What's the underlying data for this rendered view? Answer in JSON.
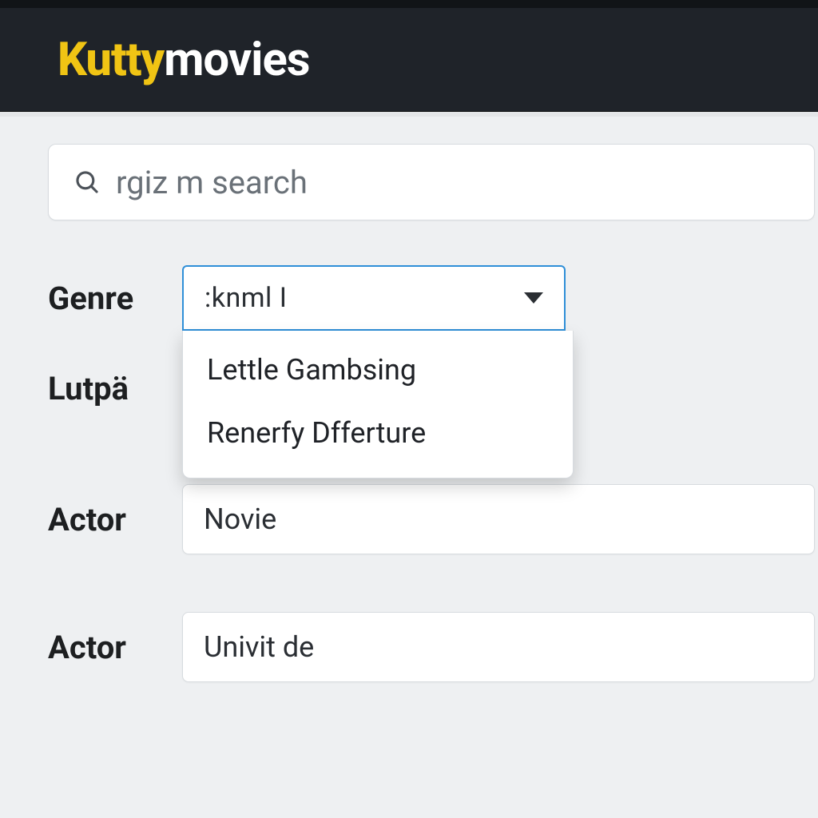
{
  "brand": {
    "accent": "Kutty",
    "rest": "movies"
  },
  "search": {
    "placeholder": "rgiz m search"
  },
  "filters": {
    "genre": {
      "label": "Genre",
      "selected": ":knml I",
      "options": [
        "Lettle Gambsing",
        "Renerfy Dfferture"
      ]
    },
    "lutpa": {
      "label": "Lutpä"
    },
    "actor1": {
      "label": "Actor",
      "value": "Novie"
    },
    "actor2": {
      "label": "Actor",
      "value": "Univit de"
    }
  }
}
